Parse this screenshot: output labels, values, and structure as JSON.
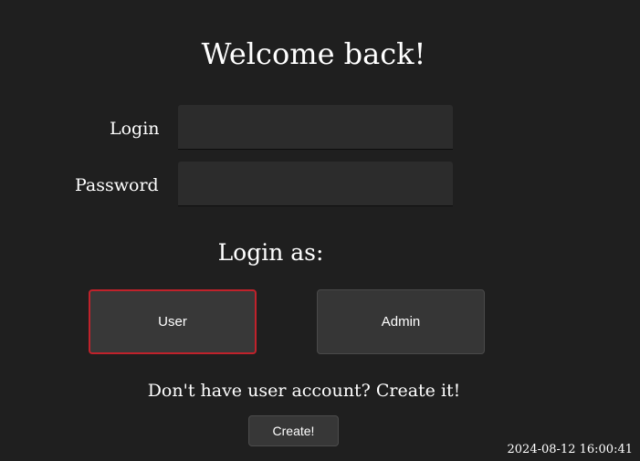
{
  "page": {
    "title": "Welcome back!"
  },
  "form": {
    "login_label": "Login",
    "login_value": "",
    "password_label": "Password",
    "password_value": ""
  },
  "role": {
    "heading": "Login as:",
    "options": [
      {
        "label": "User",
        "selected": true
      },
      {
        "label": "Admin",
        "selected": false
      }
    ]
  },
  "signup": {
    "prompt": "Don't have user account? Create it!",
    "button_label": "Create!"
  },
  "footer": {
    "timestamp": "2024-08-12 16:00:41"
  },
  "colors": {
    "background": "#1f1f1f",
    "input_background": "#2c2c2c",
    "button_background": "#363636",
    "selected_border": "#c0222b",
    "text": "#ffffff"
  }
}
